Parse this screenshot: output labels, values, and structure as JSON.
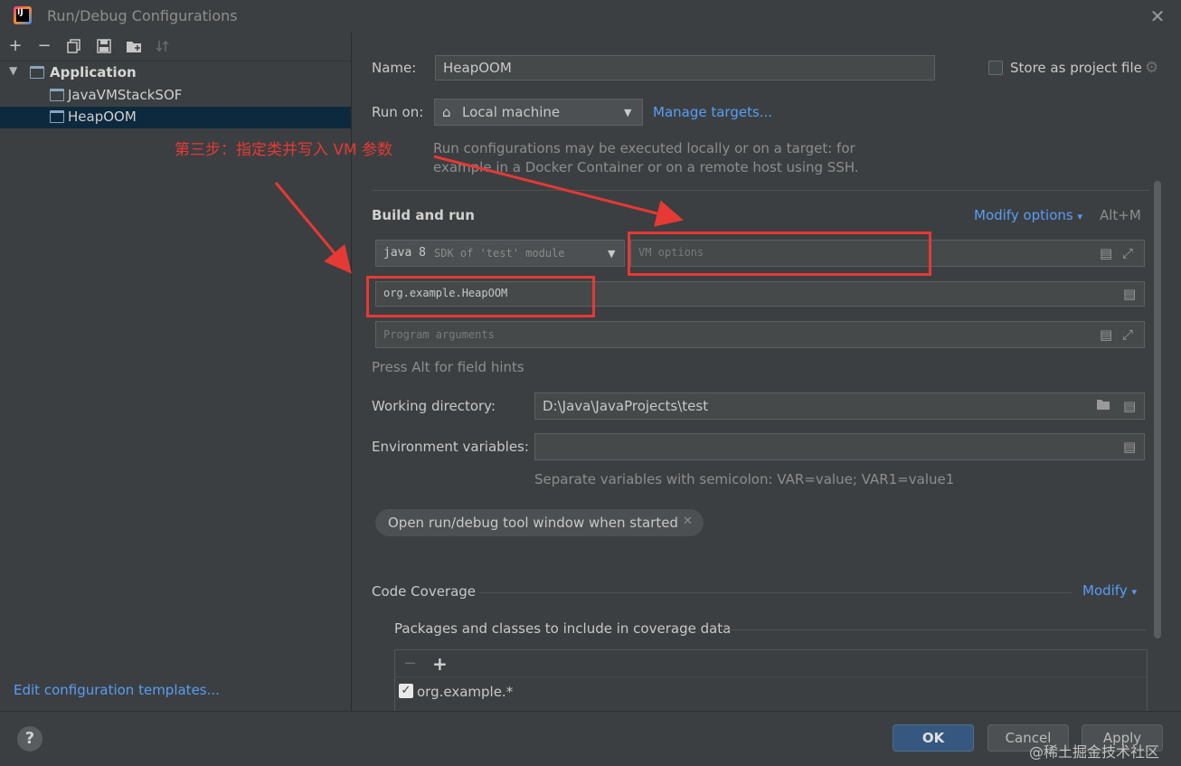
{
  "window": {
    "title": "Run/Debug Configurations",
    "logo_text": "IJ"
  },
  "sidebar": {
    "tree": {
      "group_label": "Application",
      "items": [
        {
          "label": "JavaVMStackSOF"
        },
        {
          "label": "HeapOOM",
          "selected": true
        }
      ]
    },
    "edit_templates_label": "Edit configuration templates..."
  },
  "form": {
    "name_label": "Name:",
    "name_value": "HeapOOM",
    "store_label": "Store as project file",
    "run_on_label": "Run on:",
    "run_on_value": "Local machine",
    "manage_targets_label": "Manage targets...",
    "run_on_hint_line1": "Run configurations may be executed locally or on a target: for",
    "run_on_hint_line2": "example in a Docker Container or on a remote host using SSH.",
    "build_and_run_label": "Build and run",
    "modify_options_label": "Modify options",
    "modify_options_shortcut": "Alt+M",
    "sdk_value": "java 8",
    "sdk_hint": "SDK of 'test' module",
    "vm_options_placeholder": "VM options",
    "main_class_value": "org.example.HeapOOM",
    "program_args_placeholder": "Program arguments",
    "field_hints": "Press Alt for field hints",
    "working_dir_label": "Working directory:",
    "working_dir_value": "D:\\Java\\JavaProjects\\test",
    "env_vars_label": "Environment variables:",
    "env_vars_hint": "Separate variables with semicolon: VAR=value; VAR1=value1",
    "open_tool_window_chip": "Open run/debug tool window when started",
    "code_coverage_label": "Code Coverage",
    "modify_label": "Modify",
    "coverage_packages_label": "Packages and classes to include in coverage data",
    "coverage_pattern": "org.example.*"
  },
  "buttons": {
    "ok": "OK",
    "cancel": "Cancel",
    "apply": "Apply",
    "help": "?"
  },
  "annotation": {
    "text": "第三步：指定类并写入 VM 参数",
    "color": "#e53935"
  },
  "watermark": "@稀土掘金技术社区",
  "colors": {
    "background": "#3c3f41",
    "selection": "#0d293e",
    "link": "#589df6",
    "ok_button": "#365880"
  }
}
